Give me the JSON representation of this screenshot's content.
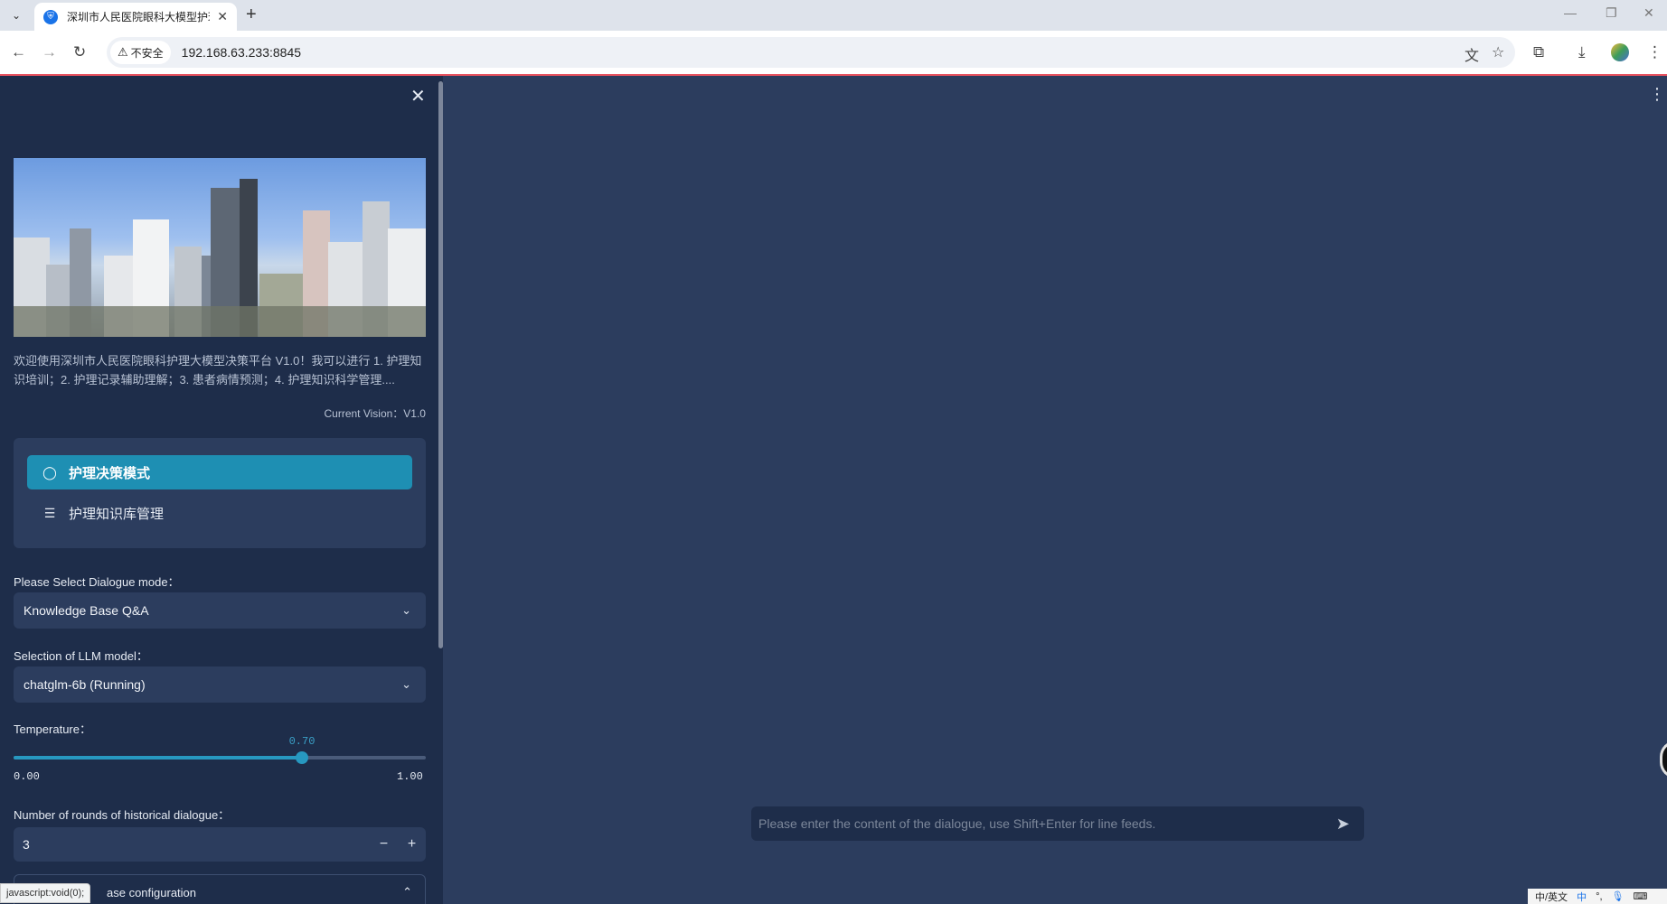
{
  "browser": {
    "tab_title": "深圳市人民医院眼科大模型护理",
    "tab_favicon": "hospital-favicon",
    "security_label": "不安全",
    "url": "192.168.63.233:8845"
  },
  "sidebar": {
    "welcome_text": "欢迎使用深圳市人民医院眼科护理大模型决策平台 V1.0！我可以进行 1. 护理知识培训；2. 护理记录辅助理解；3. 患者病情预测；4. 护理知识科学管理....",
    "version_text": "Current Vision：V1.0",
    "menu": [
      {
        "label": "护理决策模式",
        "icon": "chat-bubble-icon",
        "active": true
      },
      {
        "label": "护理知识库管理",
        "icon": "database-icon",
        "active": false
      }
    ],
    "dialogue_mode": {
      "label": "Please Select Dialogue mode：",
      "value": "Knowledge Base Q&A"
    },
    "llm_model": {
      "label": "Selection of LLM model：",
      "value": "chatglm-6b (Running)"
    },
    "temperature": {
      "label": "Temperature：",
      "value": 0.7,
      "display_value": "0.70",
      "min": "0.00",
      "max": "1.00"
    },
    "history_rounds": {
      "label": "Number of rounds of historical dialogue：",
      "value": "3",
      "minus": "−",
      "plus": "+"
    },
    "kb_config": {
      "label": "ase configuration"
    }
  },
  "main": {
    "chat_placeholder": "Please enter the content of the dialogue, use Shift+Enter for line feeds."
  },
  "status_bar": {
    "link_preview": "javascript:void(0);"
  },
  "ime": {
    "label": "中/英文",
    "mode": "中"
  },
  "colors": {
    "sidebar_bg": "#1e2d4a",
    "main_bg": "#2c3d5e",
    "accent": "#1e8fb3",
    "slider": "#2798c0"
  }
}
